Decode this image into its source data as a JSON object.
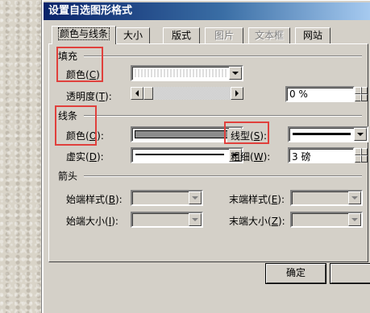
{
  "window": {
    "title": "设置自选图形格式"
  },
  "tabs": [
    {
      "label": "颜色与线条",
      "active": true,
      "enabled": true
    },
    {
      "label": "大小",
      "active": false,
      "enabled": true
    },
    {
      "label": "版式",
      "active": false,
      "enabled": true
    },
    {
      "label": "图片",
      "active": false,
      "enabled": false
    },
    {
      "label": "文本框",
      "active": false,
      "enabled": false
    },
    {
      "label": "网站",
      "active": false,
      "enabled": true
    }
  ],
  "fill": {
    "group_label": "填充",
    "color_label": "颜色",
    "color_key": "C",
    "transparency_label": "透明度",
    "transparency_key": "T",
    "transparency_value": "0 %",
    "transparency_level": 0
  },
  "line": {
    "group_label": "线条",
    "color_label": "颜色",
    "color_key": "O",
    "color_value": "#8c8c8c",
    "style_label": "线型",
    "style_key": "S",
    "dash_label": "虚实",
    "dash_key": "D",
    "weight_label": "粗细",
    "weight_key": "W",
    "weight_value": "3 磅"
  },
  "arrows": {
    "group_label": "箭头",
    "begin_style_label": "始端样式",
    "begin_style_key": "B",
    "end_style_label": "末端样式",
    "end_style_key": "E",
    "begin_size_label": "始端大小",
    "begin_size_key": "I",
    "end_size_label": "末端大小",
    "end_size_key": "Z"
  },
  "buttons": {
    "ok": "确定"
  },
  "highlight_color": "#e0403c"
}
